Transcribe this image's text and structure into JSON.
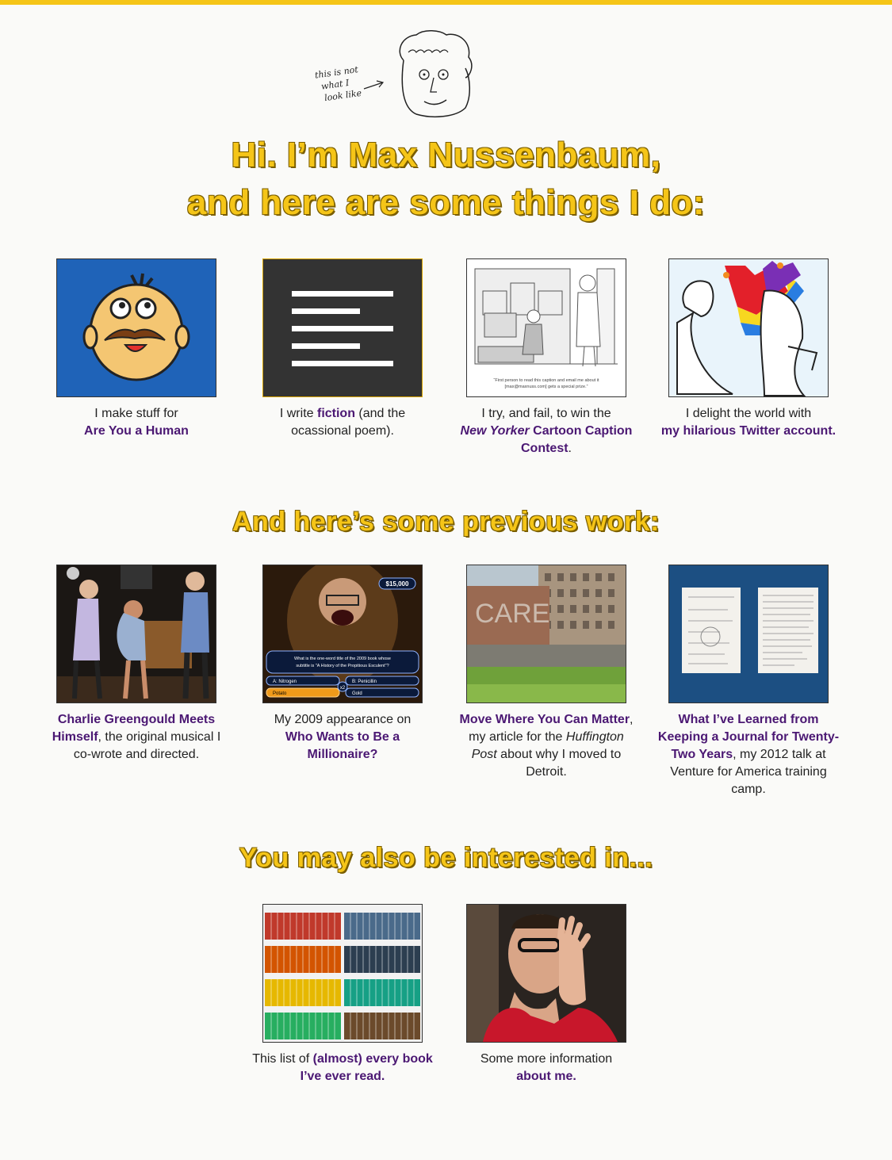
{
  "avatar_note": [
    "this is not",
    "what I",
    "look like"
  ],
  "heading": {
    "line1": "Hi. I’m Max Nussenbaum,",
    "line2": "and here are some things I do:"
  },
  "things": [
    {
      "pre": "I make stuff for",
      "link": "Are You a Human",
      "post": ""
    },
    {
      "pre": "I write ",
      "link": "fiction",
      "post": " (and the ocassional poem)."
    },
    {
      "pre": "I try, and fail, to win the",
      "link_italic": "New Yorker",
      "link": " Cartoon Caption Contest",
      "post": "."
    },
    {
      "pre": "I delight the world with",
      "link": "my hilarious Twitter account.",
      "post": ""
    }
  ],
  "cartoon_caption": "“First person to read this caption and email me about it [max@maxnuss.com] gets a special prize.”",
  "previous_heading": "And here’s some previous work:",
  "previous": [
    {
      "link": "Charlie Greengould Meets Himself",
      "post": ", the original musical I co-wrote and directed."
    },
    {
      "pre": "My 2009 appearance on",
      "link": "Who Wants to Be a Millionaire?"
    },
    {
      "link": "Move Where You Can Matter",
      "post": ", my article for the",
      "italic": "Huffington Post",
      "post2": " about why I moved to Detroit."
    },
    {
      "link": "What I’ve Learned from Keeping a Journal for Twenty-Two Years",
      "post": ", my 2012 talk at Venture for America training camp."
    }
  ],
  "millionaire": {
    "amount": "$15,000",
    "question": "What is the one-word title of the 2009 book whose subtitle is \"A History of the Propitious Esculent\"?",
    "answers": [
      "A: Nitrogen",
      "B: Penicillin",
      "Potato",
      "Gold"
    ],
    "lifeline": "x2"
  },
  "care_wall_text": "CARE",
  "interest_heading": "You may also be interested in...",
  "interest": [
    {
      "pre": "This list of ",
      "link": "(almost) every book I’ve ever read.",
      "post": ""
    },
    {
      "pre": "Some more information",
      "link": "about me.",
      "post": ""
    }
  ],
  "colors": {
    "accent": "#f5c518",
    "link": "#4b1873",
    "heading_outline": "#7a5e00"
  }
}
